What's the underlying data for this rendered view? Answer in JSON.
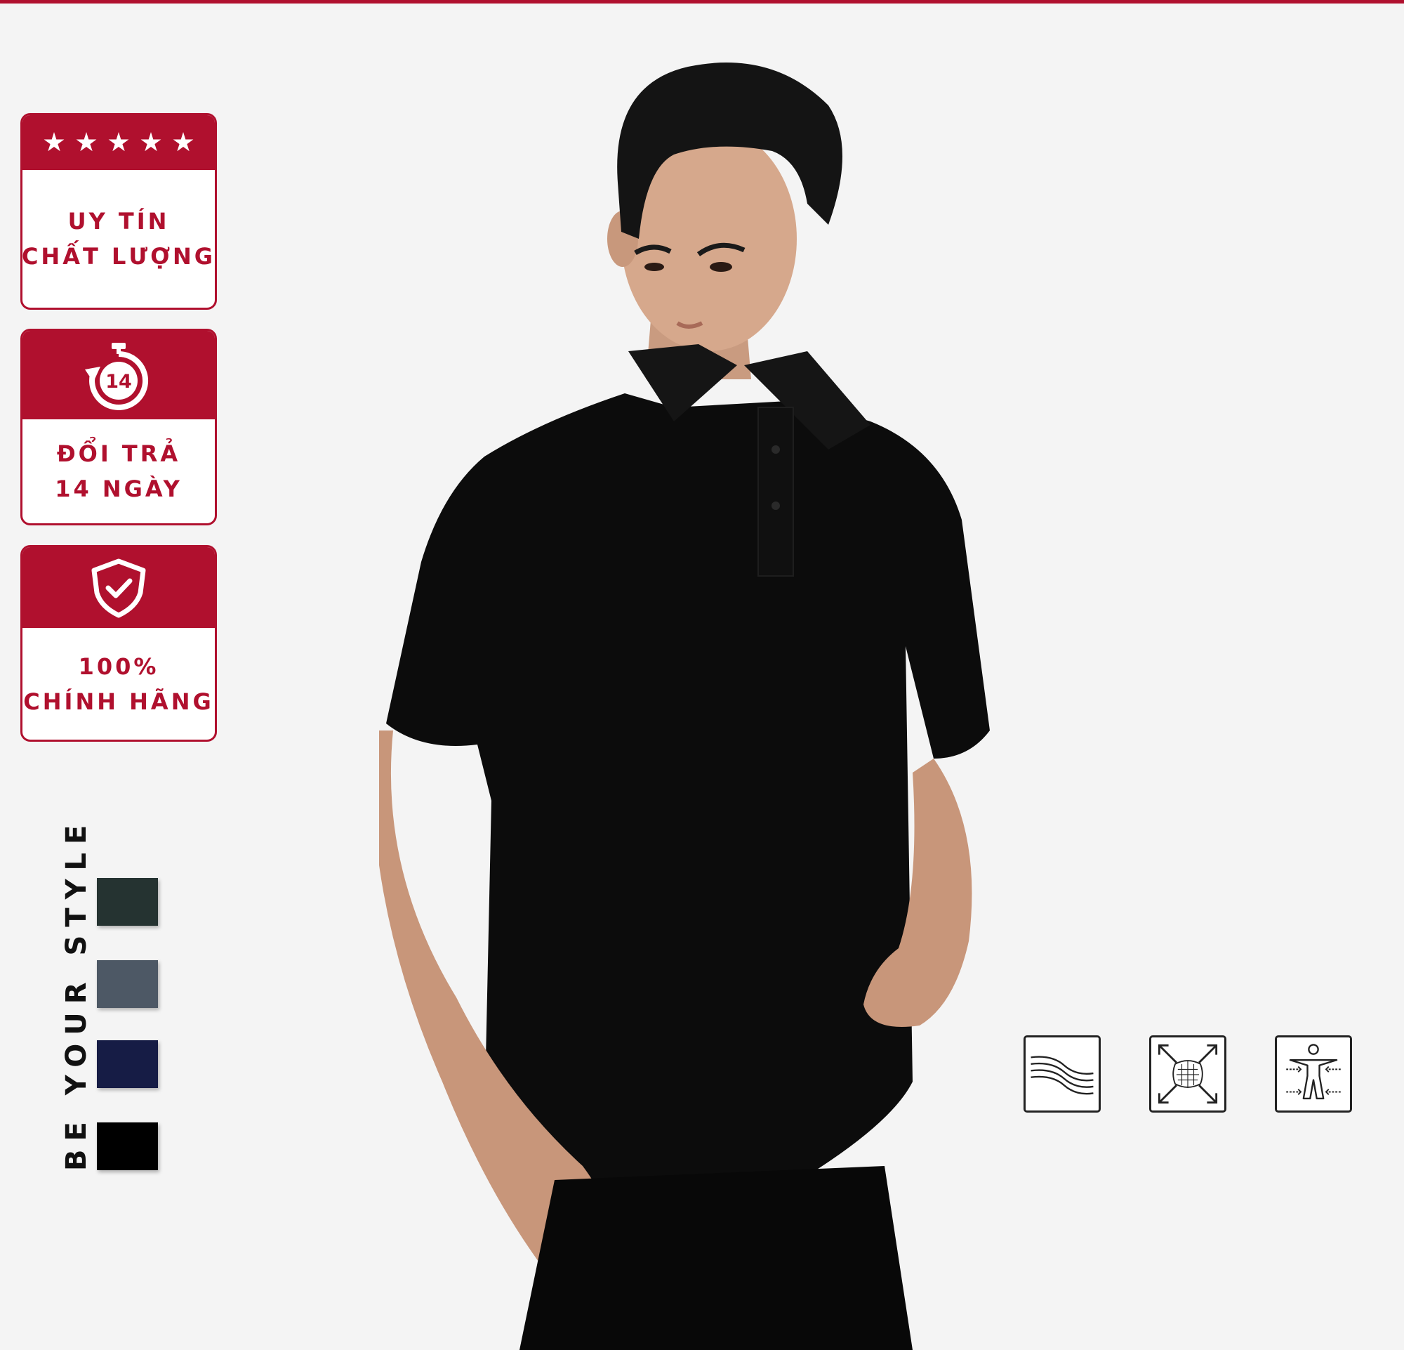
{
  "badges": [
    {
      "icon": "five-stars-icon",
      "rating": 5,
      "line1": "UY TÍN",
      "line2": "CHẤT LƯỢNG"
    },
    {
      "icon": "return-14-days-icon",
      "icon_text": "14",
      "line1": "ĐỔI TRẢ",
      "line2": "14 NGÀY"
    },
    {
      "icon": "shield-check-icon",
      "line1": "100%",
      "line2": "CHÍNH HÃNG"
    }
  ],
  "tagline": "BE YOUR STYLE",
  "color_swatches": [
    {
      "name": "dark-green",
      "color": "#253331"
    },
    {
      "name": "slate-gray",
      "color": "#4d5865"
    },
    {
      "name": "navy",
      "color": "#161c45"
    },
    {
      "name": "black",
      "color": "#000000"
    }
  ],
  "features": [
    {
      "icon": "fabric-wave-icon"
    },
    {
      "icon": "stretch-fabric-icon"
    },
    {
      "icon": "body-fit-icon"
    }
  ],
  "colors": {
    "accent": "#b0102e",
    "background": "#f4f4f4"
  }
}
